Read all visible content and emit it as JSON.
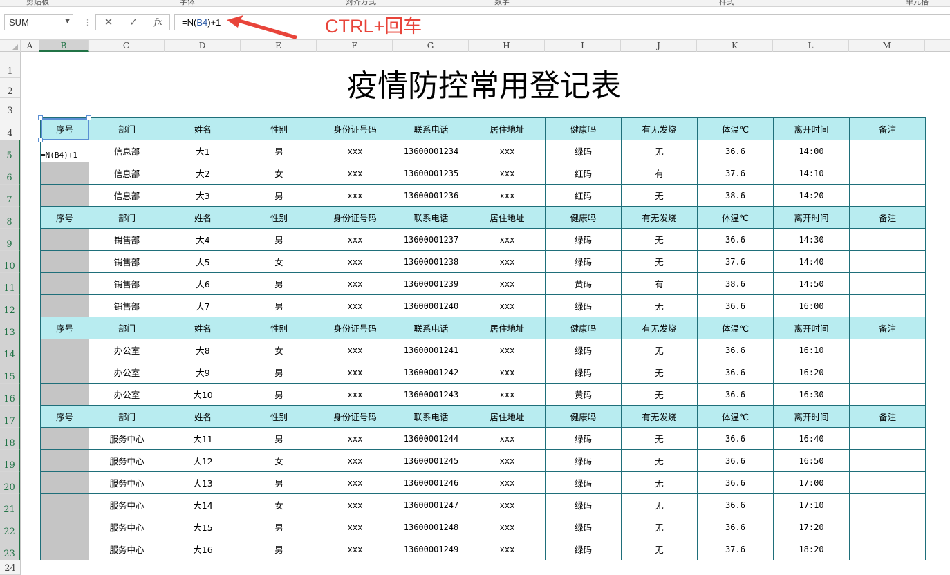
{
  "ribbon": {
    "groups": [
      "剪贴板",
      "字体",
      "对齐方式",
      "数字",
      "样式",
      "单元格"
    ]
  },
  "formula_bar": {
    "name_box": "SUM",
    "cancel_icon": "✕",
    "enter_icon": "✓",
    "fx_icon": "fx",
    "formula_prefix": "=N(",
    "formula_ref": "B4",
    "formula_suffix": ")+1",
    "annotation": "CTRL+回车"
  },
  "columns": [
    "A",
    "B",
    "C",
    "D",
    "E",
    "F",
    "G",
    "H",
    "I",
    "J",
    "K",
    "L",
    "M"
  ],
  "rows": [
    "1",
    "2",
    "3",
    "4",
    "5",
    "6",
    "7",
    "8",
    "9",
    "10",
    "11",
    "12",
    "13",
    "14",
    "15",
    "16",
    "17",
    "18",
    "19",
    "20",
    "21",
    "22",
    "23",
    "24"
  ],
  "sheet": {
    "title": "疫情防控常用登记表",
    "headers": [
      "序号",
      "部门",
      "姓名",
      "性别",
      "身份证号码",
      "联系电话",
      "居住地址",
      "健康吗",
      "有无发烧",
      "体温℃",
      "离开时间",
      "备注"
    ],
    "active_cell_formula": "=N(B4)+1",
    "groups": [
      {
        "rows": [
          [
            "信息部",
            "大1",
            "男",
            "xxx",
            "13600001234",
            "xxx",
            "绿码",
            "无",
            "36.6",
            "14:00",
            ""
          ],
          [
            "信息部",
            "大2",
            "女",
            "xxx",
            "13600001235",
            "xxx",
            "红码",
            "有",
            "37.6",
            "14:10",
            ""
          ],
          [
            "信息部",
            "大3",
            "男",
            "xxx",
            "13600001236",
            "xxx",
            "红码",
            "无",
            "38.6",
            "14:20",
            ""
          ]
        ]
      },
      {
        "rows": [
          [
            "销售部",
            "大4",
            "男",
            "xxx",
            "13600001237",
            "xxx",
            "绿码",
            "无",
            "36.6",
            "14:30",
            ""
          ],
          [
            "销售部",
            "大5",
            "女",
            "xxx",
            "13600001238",
            "xxx",
            "绿码",
            "无",
            "37.6",
            "14:40",
            ""
          ],
          [
            "销售部",
            "大6",
            "男",
            "xxx",
            "13600001239",
            "xxx",
            "黄码",
            "有",
            "38.6",
            "14:50",
            ""
          ],
          [
            "销售部",
            "大7",
            "男",
            "xxx",
            "13600001240",
            "xxx",
            "绿码",
            "无",
            "36.6",
            "16:00",
            ""
          ]
        ]
      },
      {
        "rows": [
          [
            "办公室",
            "大8",
            "女",
            "xxx",
            "13600001241",
            "xxx",
            "绿码",
            "无",
            "36.6",
            "16:10",
            ""
          ],
          [
            "办公室",
            "大9",
            "男",
            "xxx",
            "13600001242",
            "xxx",
            "绿码",
            "无",
            "36.6",
            "16:20",
            ""
          ],
          [
            "办公室",
            "大10",
            "男",
            "xxx",
            "13600001243",
            "xxx",
            "黄码",
            "无",
            "36.6",
            "16:30",
            ""
          ]
        ]
      },
      {
        "rows": [
          [
            "服务中心",
            "大11",
            "男",
            "xxx",
            "13600001244",
            "xxx",
            "绿码",
            "无",
            "36.6",
            "16:40",
            ""
          ],
          [
            "服务中心",
            "大12",
            "女",
            "xxx",
            "13600001245",
            "xxx",
            "绿码",
            "无",
            "36.6",
            "16:50",
            ""
          ],
          [
            "服务中心",
            "大13",
            "男",
            "xxx",
            "13600001246",
            "xxx",
            "绿码",
            "无",
            "36.6",
            "17:00",
            ""
          ],
          [
            "服务中心",
            "大14",
            "女",
            "xxx",
            "13600001247",
            "xxx",
            "绿码",
            "无",
            "36.6",
            "17:10",
            ""
          ],
          [
            "服务中心",
            "大15",
            "男",
            "xxx",
            "13600001248",
            "xxx",
            "绿码",
            "无",
            "36.6",
            "17:20",
            ""
          ],
          [
            "服务中心",
            "大16",
            "男",
            "xxx",
            "13600001249",
            "xxx",
            "绿码",
            "无",
            "37.6",
            "18:20",
            ""
          ]
        ]
      }
    ]
  },
  "colors": {
    "header_fill": "#b8ecf0",
    "blank_seq_fill": "#c5c5c5",
    "border": "#1f6f7a",
    "annotation": "#e8443a",
    "selection": "#217346"
  }
}
